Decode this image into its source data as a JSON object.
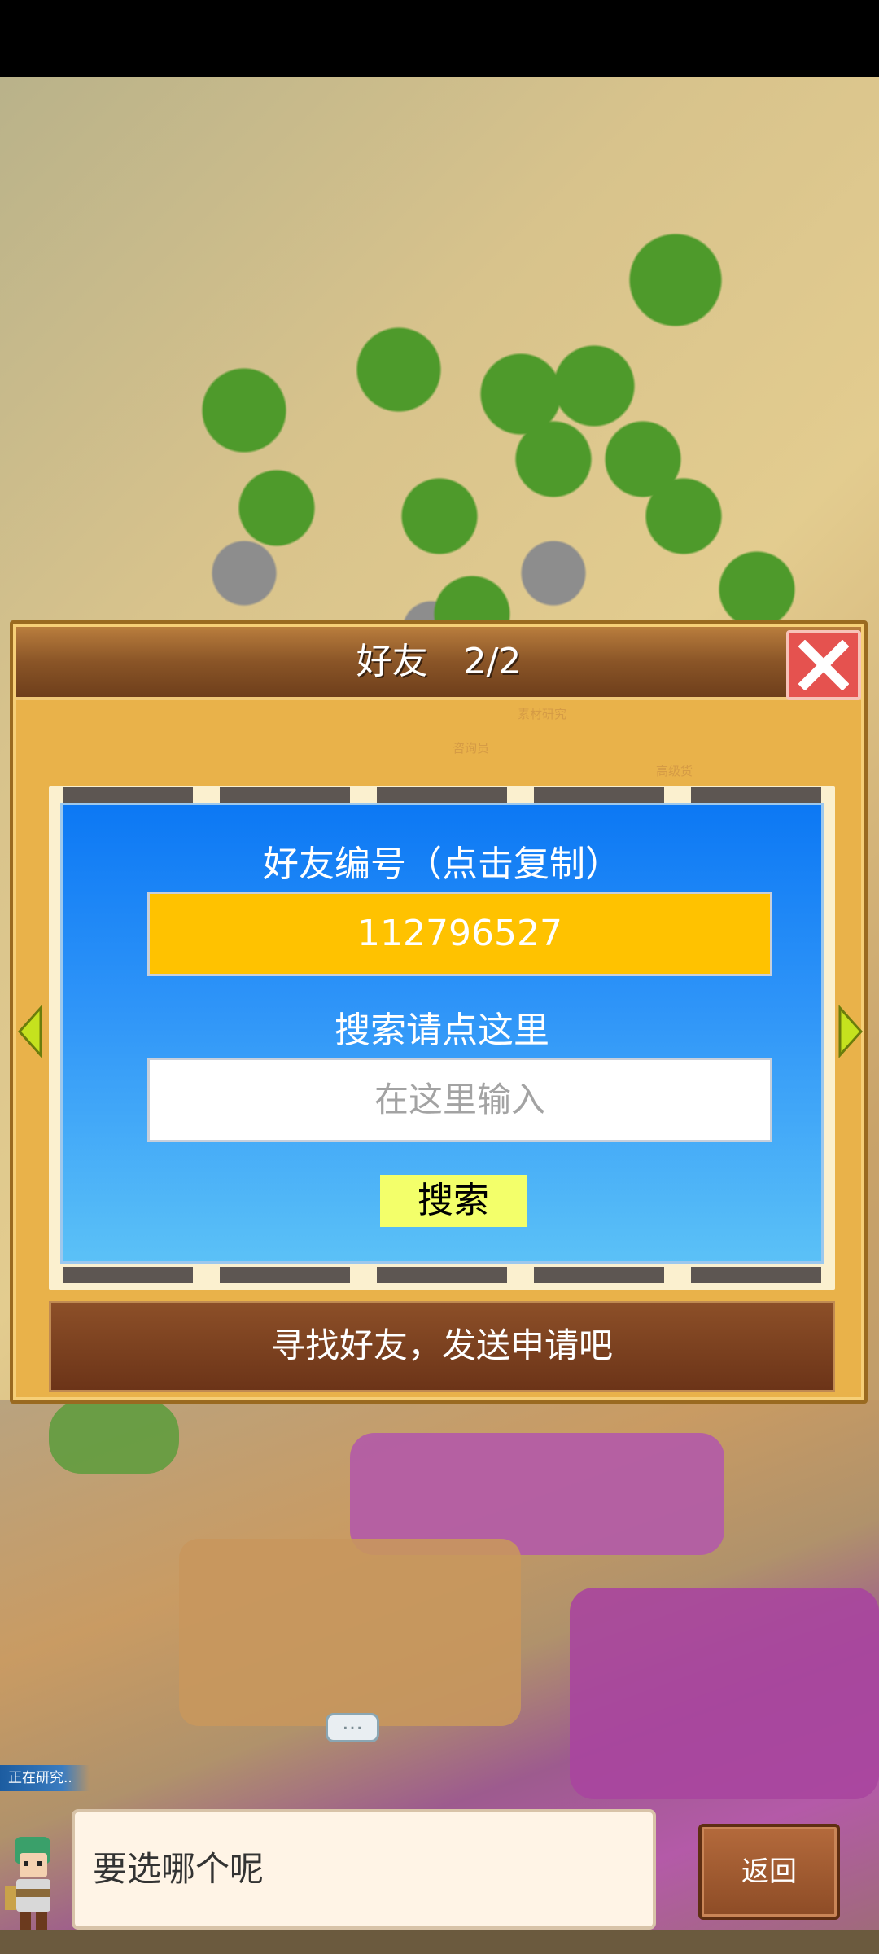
{
  "dialog": {
    "title": "好友　2/2",
    "background_labels": [
      "素材研究",
      "咨询员",
      "高级货"
    ],
    "friend_id_label": "好友编号（点击复制）",
    "friend_id": "112796527",
    "search_label": "搜索请点这里",
    "search_placeholder": "在这里输入",
    "search_button": "搜索",
    "send_request": "寻找好友，发送申请吧"
  },
  "hud": {
    "chat_bubble": "…",
    "research_status": "正在研究..",
    "message": "要选哪个呢",
    "back_button": "返回"
  },
  "colors": {
    "panel_blue": "#0c78f4",
    "id_box": "#ffc200",
    "search_button": "#f3ff6a",
    "close_button": "#e5524f"
  },
  "icons": {
    "close": "close-icon",
    "left": "arrow-left-icon",
    "right": "arrow-right-icon",
    "chat": "chat-bubble-icon",
    "avatar": "character-avatar"
  }
}
